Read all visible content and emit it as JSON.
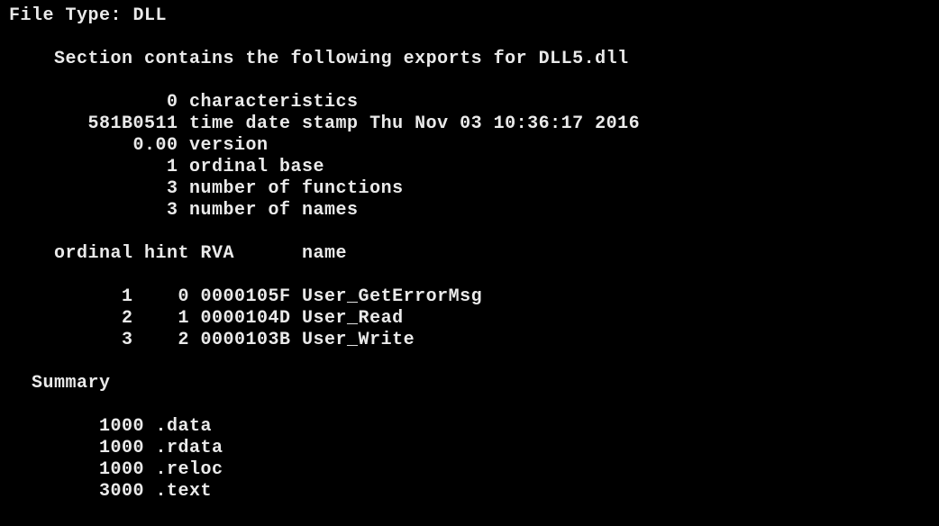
{
  "file_type_label": "File Type: ",
  "file_type_value": "DLL",
  "exports_header": "    Section contains the following exports for DLL5.dll",
  "header_lines": {
    "characteristics": "              0 characteristics",
    "timestamp": "       581B0511 time date stamp Thu Nov 03 10:36:17 2016",
    "version": "           0.00 version",
    "ordinal_base": "              1 ordinal base",
    "num_functions": "              3 number of functions",
    "num_names": "              3 number of names"
  },
  "table_header": "    ordinal hint RVA      name",
  "exports": [
    "          1    0 0000105F User_GetErrorMsg",
    "          2    1 0000104D User_Read",
    "          3    2 0000103B User_Write"
  ],
  "summary_label": "  Summary",
  "summary_lines": [
    "        1000 .data",
    "        1000 .rdata",
    "        1000 .reloc",
    "        3000 .text"
  ]
}
